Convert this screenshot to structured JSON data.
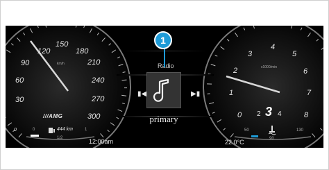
{
  "callout": {
    "number": "1"
  },
  "speedometer": {
    "ticks": [
      "0",
      "30",
      "60",
      "90",
      "120",
      "150",
      "180",
      "210",
      "240",
      "270",
      "300"
    ],
    "unit": "km/h",
    "logo": "///AMG",
    "range": "444 km",
    "fuel_level": "1/2",
    "fuel_empty": "0",
    "fuel_full": "1",
    "clock": "12:00am"
  },
  "media": {
    "source": "Radio",
    "station": "primary",
    "prev_icon": "skip-previous-icon",
    "next_icon": "skip-next-icon",
    "art_icon": "music-note-icon"
  },
  "tachometer": {
    "ticks": [
      "0",
      "1",
      "2",
      "3",
      "4",
      "5",
      "6",
      "7",
      "8"
    ],
    "unit": "x1000/min",
    "gears": [
      "2",
      "3",
      "4"
    ],
    "current_gear": "3",
    "temp_low": "50",
    "temp_mid": "90",
    "temp_high": "130",
    "temp_icon": "coolant-temp-icon",
    "outside_temp": "22.0°C"
  },
  "colors": {
    "accent": "#1e9bd7",
    "background": "#000000",
    "needle": "#d8d8d8"
  }
}
